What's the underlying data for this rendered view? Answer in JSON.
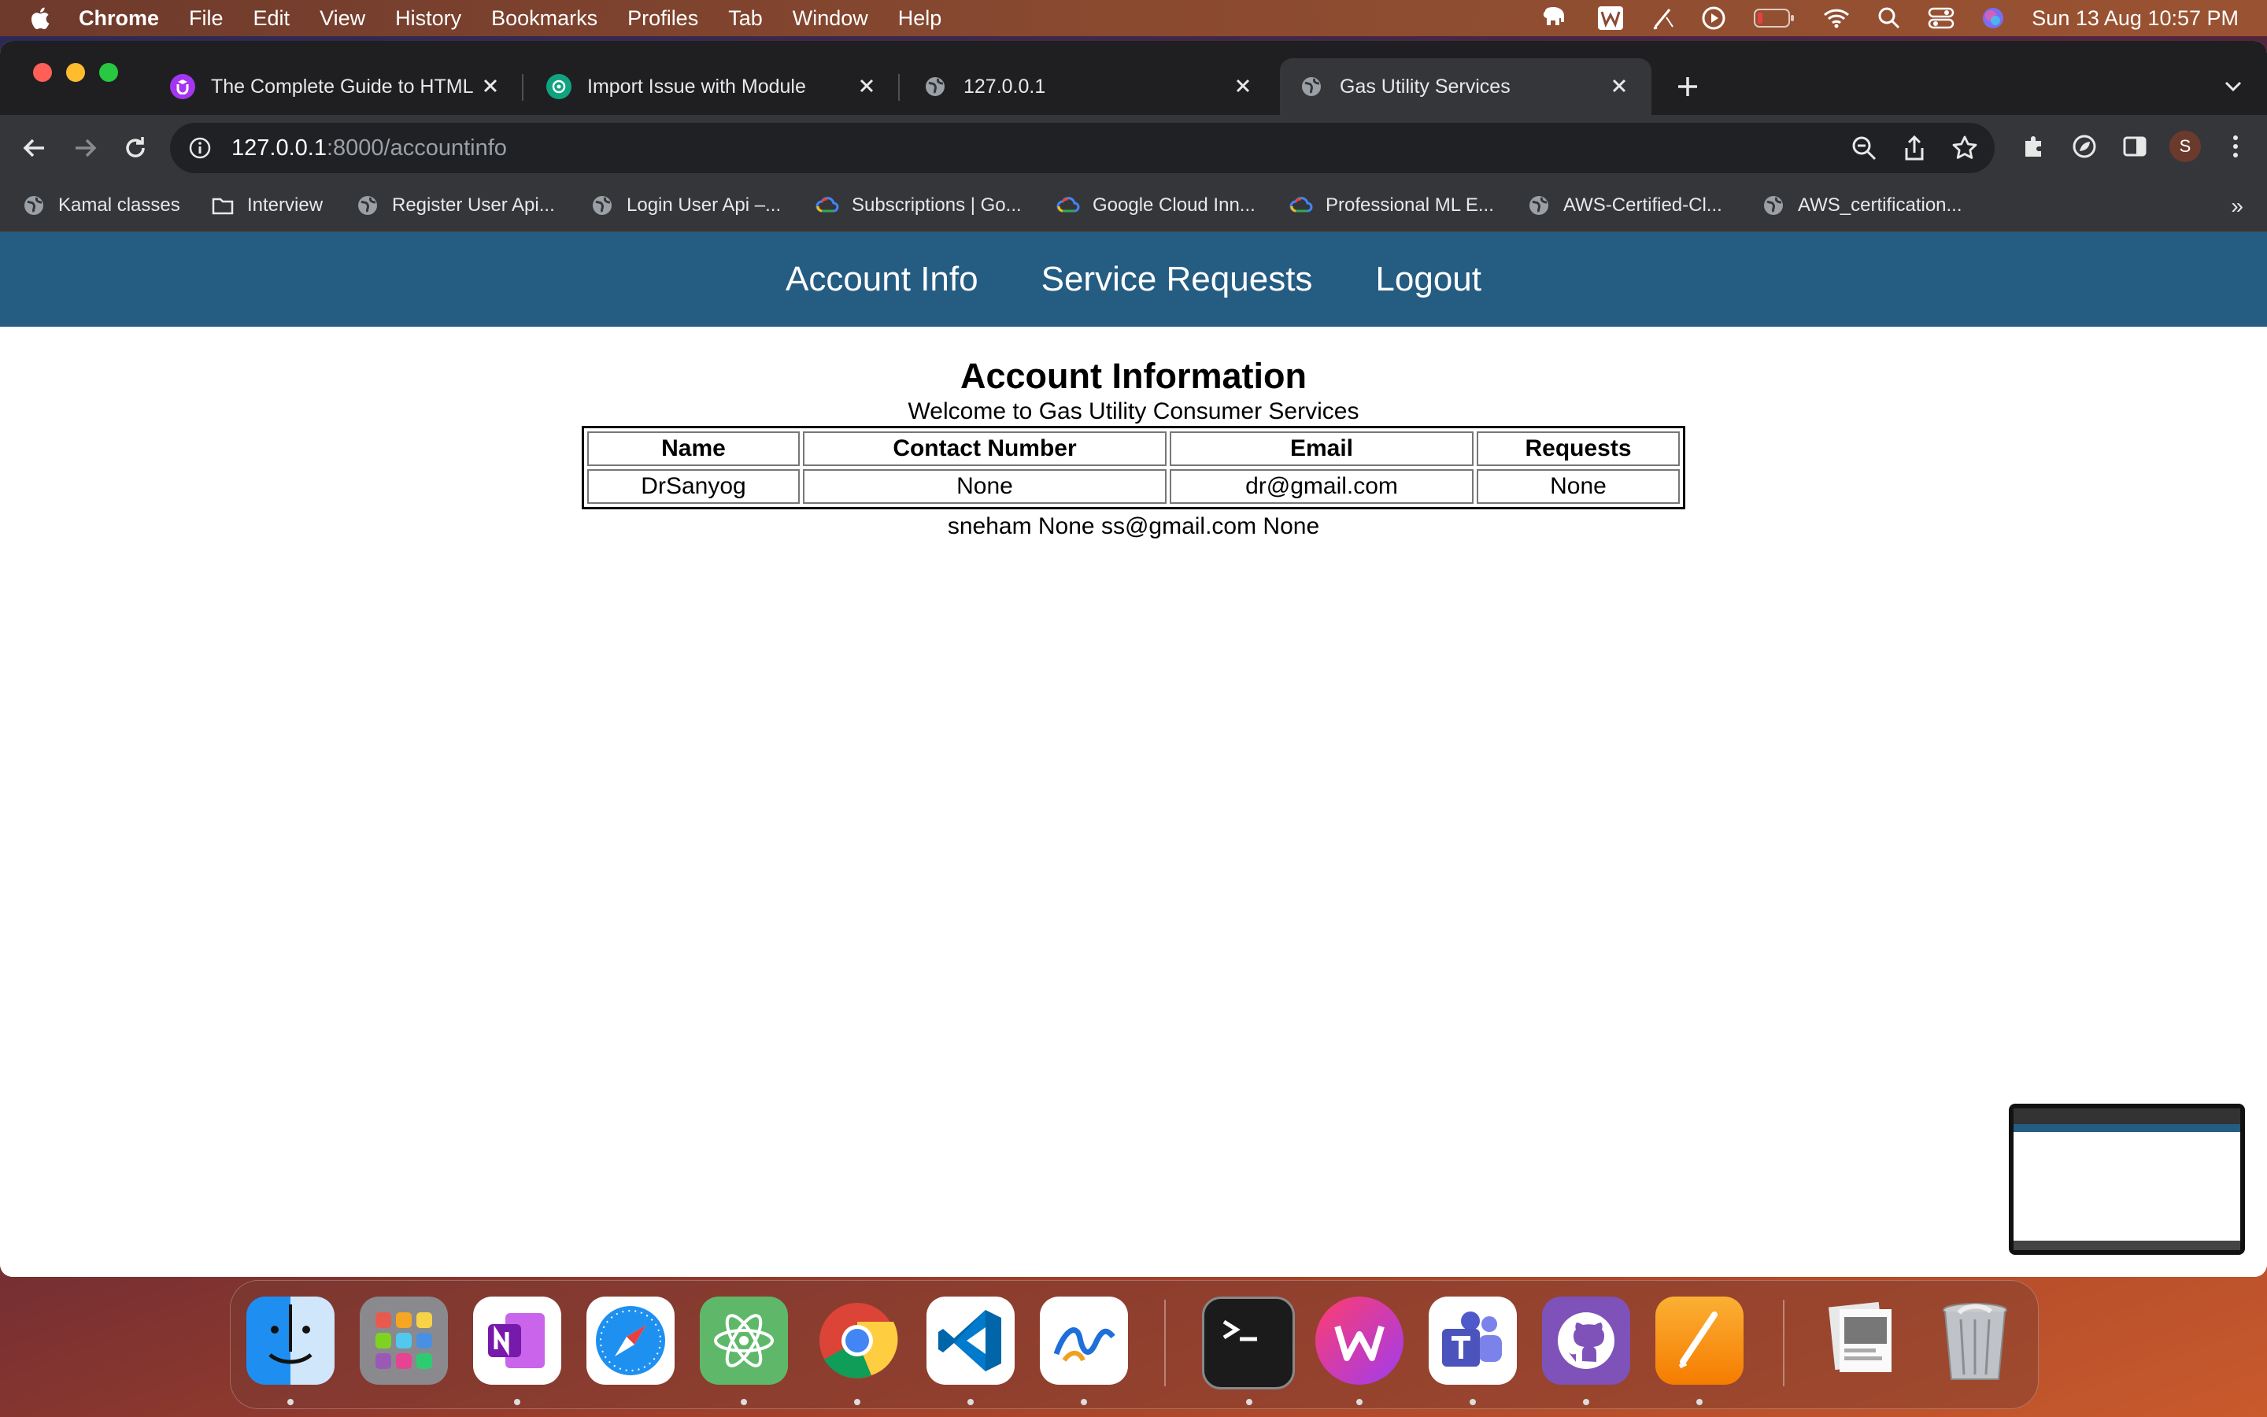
{
  "menubar": {
    "app": "Chrome",
    "items": [
      "File",
      "Edit",
      "View",
      "History",
      "Bookmarks",
      "Profiles",
      "Tab",
      "Window",
      "Help"
    ],
    "clock": "Sun 13 Aug  10:57 PM"
  },
  "tabs": [
    {
      "title": "The Complete Guide to HTML |",
      "icon": "udemy-icon"
    },
    {
      "title": "Import Issue with Module",
      "icon": "chatgpt-icon"
    },
    {
      "title": "127.0.0.1",
      "icon": "globe-icon"
    },
    {
      "title": "Gas Utility Services",
      "icon": "globe-icon",
      "active": true
    }
  ],
  "address": {
    "host": "127.0.0.1",
    "path": ":8000/accountinfo"
  },
  "bookmarks": [
    {
      "label": "Kamal classes",
      "icon": "globe-icon"
    },
    {
      "label": "Interview",
      "icon": "folder-icon"
    },
    {
      "label": "Register User Api...",
      "icon": "globe-icon"
    },
    {
      "label": "Login User Api –...",
      "icon": "globe-icon"
    },
    {
      "label": "Subscriptions | Go...",
      "icon": "google-cloud-icon"
    },
    {
      "label": "Google Cloud Inn...",
      "icon": "google-cloud-icon"
    },
    {
      "label": "Professional ML E...",
      "icon": "google-cloud-icon"
    },
    {
      "label": "AWS-Certified-Cl...",
      "icon": "globe-icon"
    },
    {
      "label": "AWS_certification...",
      "icon": "globe-icon"
    }
  ],
  "profile_initial": "S",
  "site": {
    "nav": [
      "Account Info",
      "Service Requests",
      "Logout"
    ],
    "heading": "Account Information",
    "welcome": "Welcome to Gas Utility Consumer Services",
    "table": {
      "headers": [
        "Name",
        "Contact Number",
        "Email",
        "Requests"
      ],
      "rows": [
        [
          "DrSanyog",
          "None",
          "dr@gmail.com",
          "None"
        ]
      ]
    },
    "stray_row": "sneham None ss@gmail.com None",
    "colors": {
      "nav_bg": "#255c82"
    }
  },
  "dock": [
    "Finder",
    "Launchpad",
    "OneNote",
    "Safari",
    "Atom",
    "Chrome",
    "Visual Studio Code",
    "Freeform",
    "Terminal",
    "WPS Office",
    "Teams",
    "GitHub Desktop",
    "Pages",
    "Preview",
    "Trash"
  ]
}
